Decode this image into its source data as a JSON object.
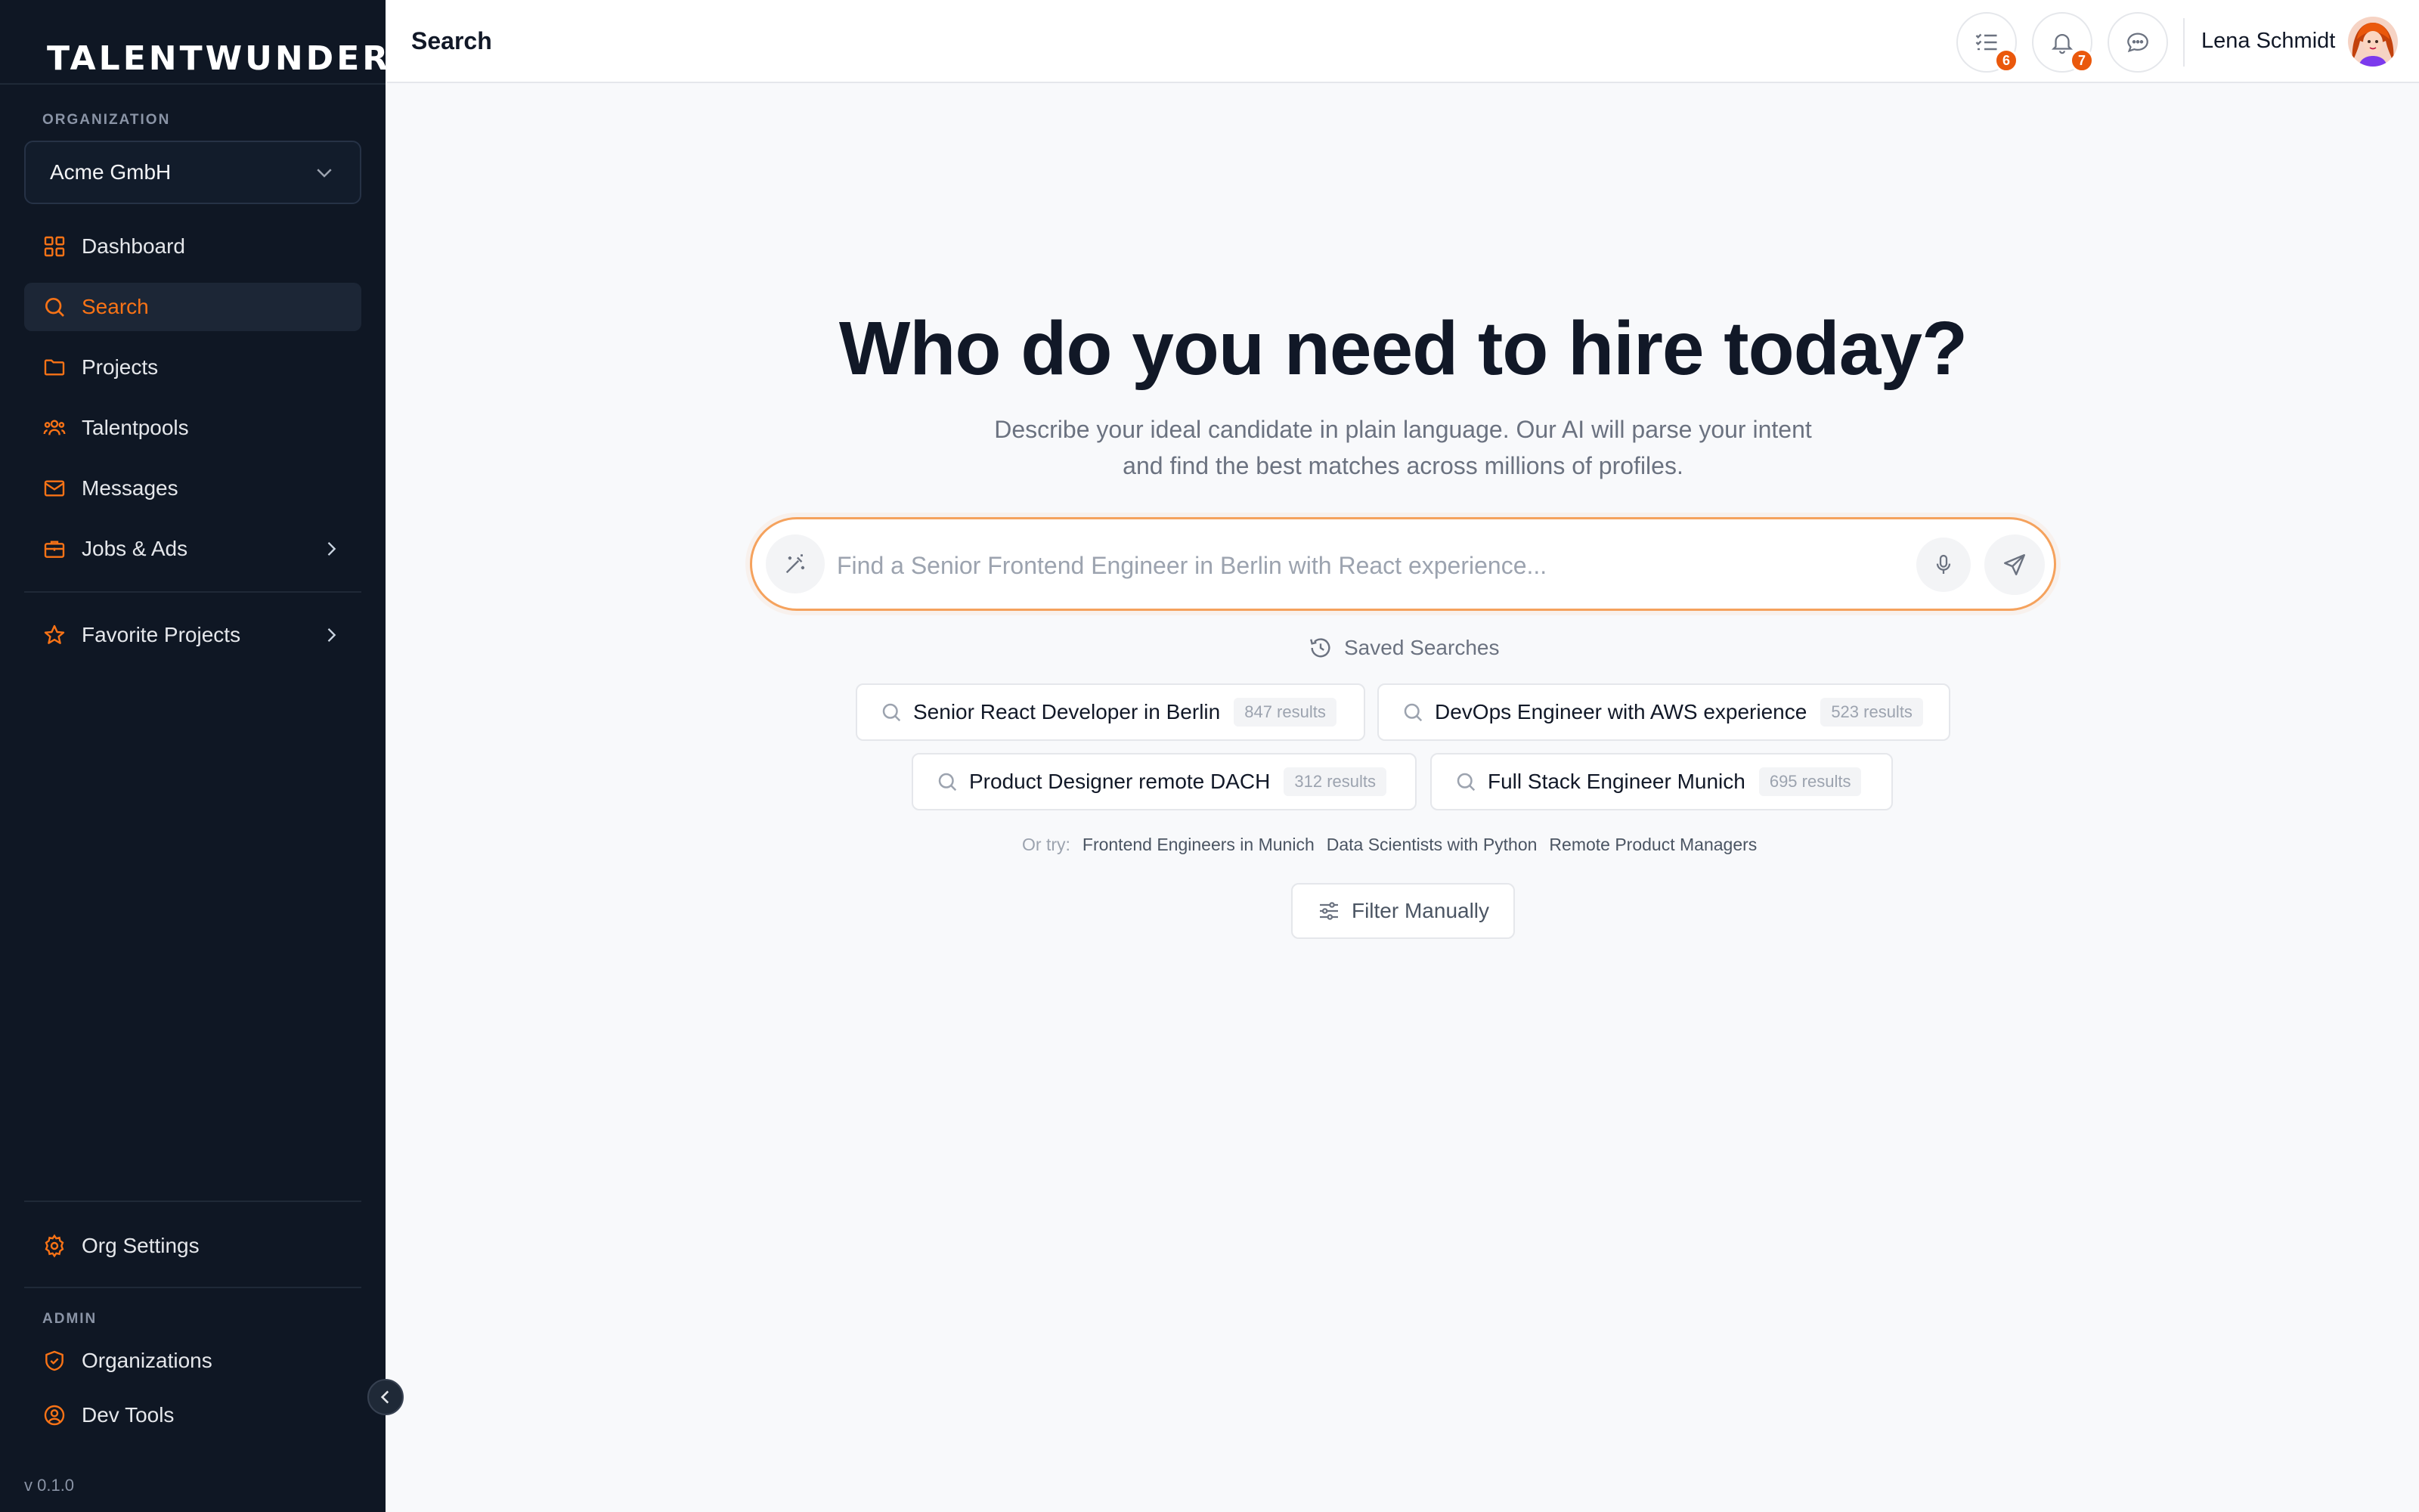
{
  "app": {
    "logo_text": "TALENTWUNDER",
    "accent_color": "#f97316"
  },
  "sidebar": {
    "org_section_label": "ORGANIZATION",
    "org_selected": "Acme GmbH",
    "items": [
      {
        "label": "Dashboard",
        "icon": "grid-icon"
      },
      {
        "label": "Search",
        "icon": "search-icon",
        "active": true
      },
      {
        "label": "Projects",
        "icon": "folder-icon"
      },
      {
        "label": "Talentpools",
        "icon": "users-icon"
      },
      {
        "label": "Messages",
        "icon": "mail-icon"
      },
      {
        "label": "Jobs & Ads",
        "icon": "briefcase-icon"
      }
    ],
    "favorites_label": "Favorite Projects",
    "org_settings_label": "Org Settings",
    "admin_section_label": "ADMIN",
    "admin_items": [
      {
        "label": "Organizations",
        "icon": "shield-icon"
      },
      {
        "label": "Dev Tools",
        "icon": "user-circle-icon"
      }
    ],
    "version": "v 0.1.0"
  },
  "topbar": {
    "title": "Search",
    "tasks_badge": "6",
    "notifications_badge": "7",
    "user_name": "Lena Schmidt"
  },
  "main": {
    "headline": "Who do you need to hire today?",
    "subtitle": "Describe your ideal candidate in plain language. Our AI will parse your intent and find the best matches across millions of profiles.",
    "search_placeholder": "Find a Senior Frontend Engineer in Berlin with React experience...",
    "search_value": "",
    "saved_searches_label": "Saved Searches",
    "saved_searches": [
      {
        "label": "Senior React Developer in Berlin",
        "count": "847 results"
      },
      {
        "label": "DevOps Engineer with AWS experience",
        "count": "523 results"
      },
      {
        "label": "Product Designer remote DACH",
        "count": "312 results"
      },
      {
        "label": "Full Stack Engineer Munich",
        "count": "695 results"
      }
    ],
    "or_try_label": "Or try:",
    "suggestions": [
      "Frontend Engineers in Munich",
      "Data Scientists with Python",
      "Remote Product Managers"
    ],
    "filter_label": "Filter Manually"
  }
}
